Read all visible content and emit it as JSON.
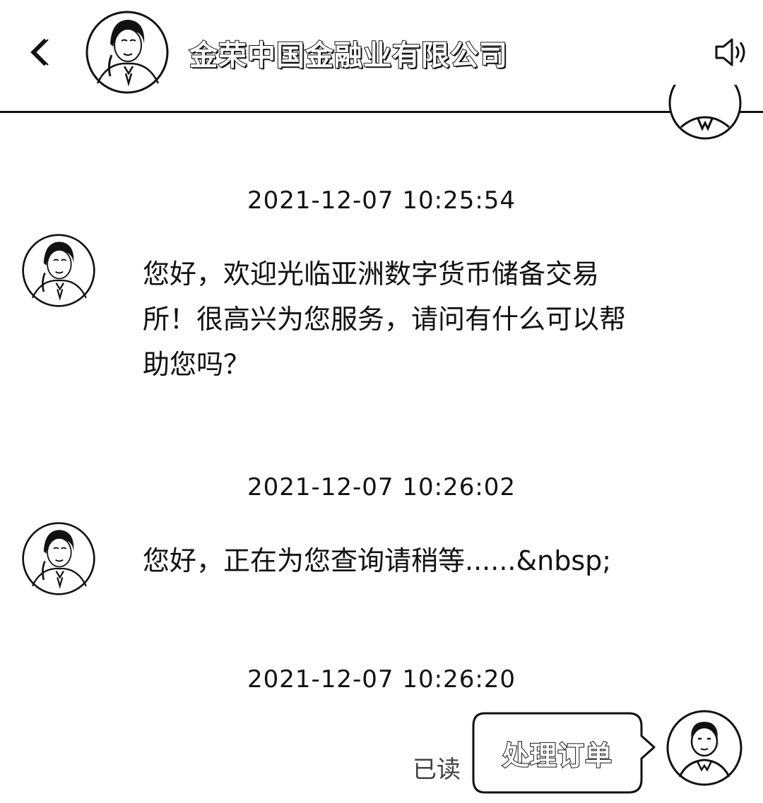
{
  "header": {
    "title": "金荣中国金融业有限公司",
    "back_icon": "chevron-left-icon",
    "sound_icon": "speaker-icon"
  },
  "messages": [
    {
      "timestamp": "2021-12-07 10:25:54",
      "lines": [
        "您好，欢迎光临亚洲数字货币储备交易",
        "所！很高兴为您服务，请问有什么可以帮",
        "助您吗？"
      ]
    },
    {
      "timestamp": "2021-12-07 10:26:02",
      "lines": [
        "您好，正在为您查询请稍等......&nbsp;"
      ]
    }
  ],
  "outgoing": {
    "timestamp": "2021-12-07 10:26:20",
    "read_status": "已读",
    "text": "处理订单"
  }
}
